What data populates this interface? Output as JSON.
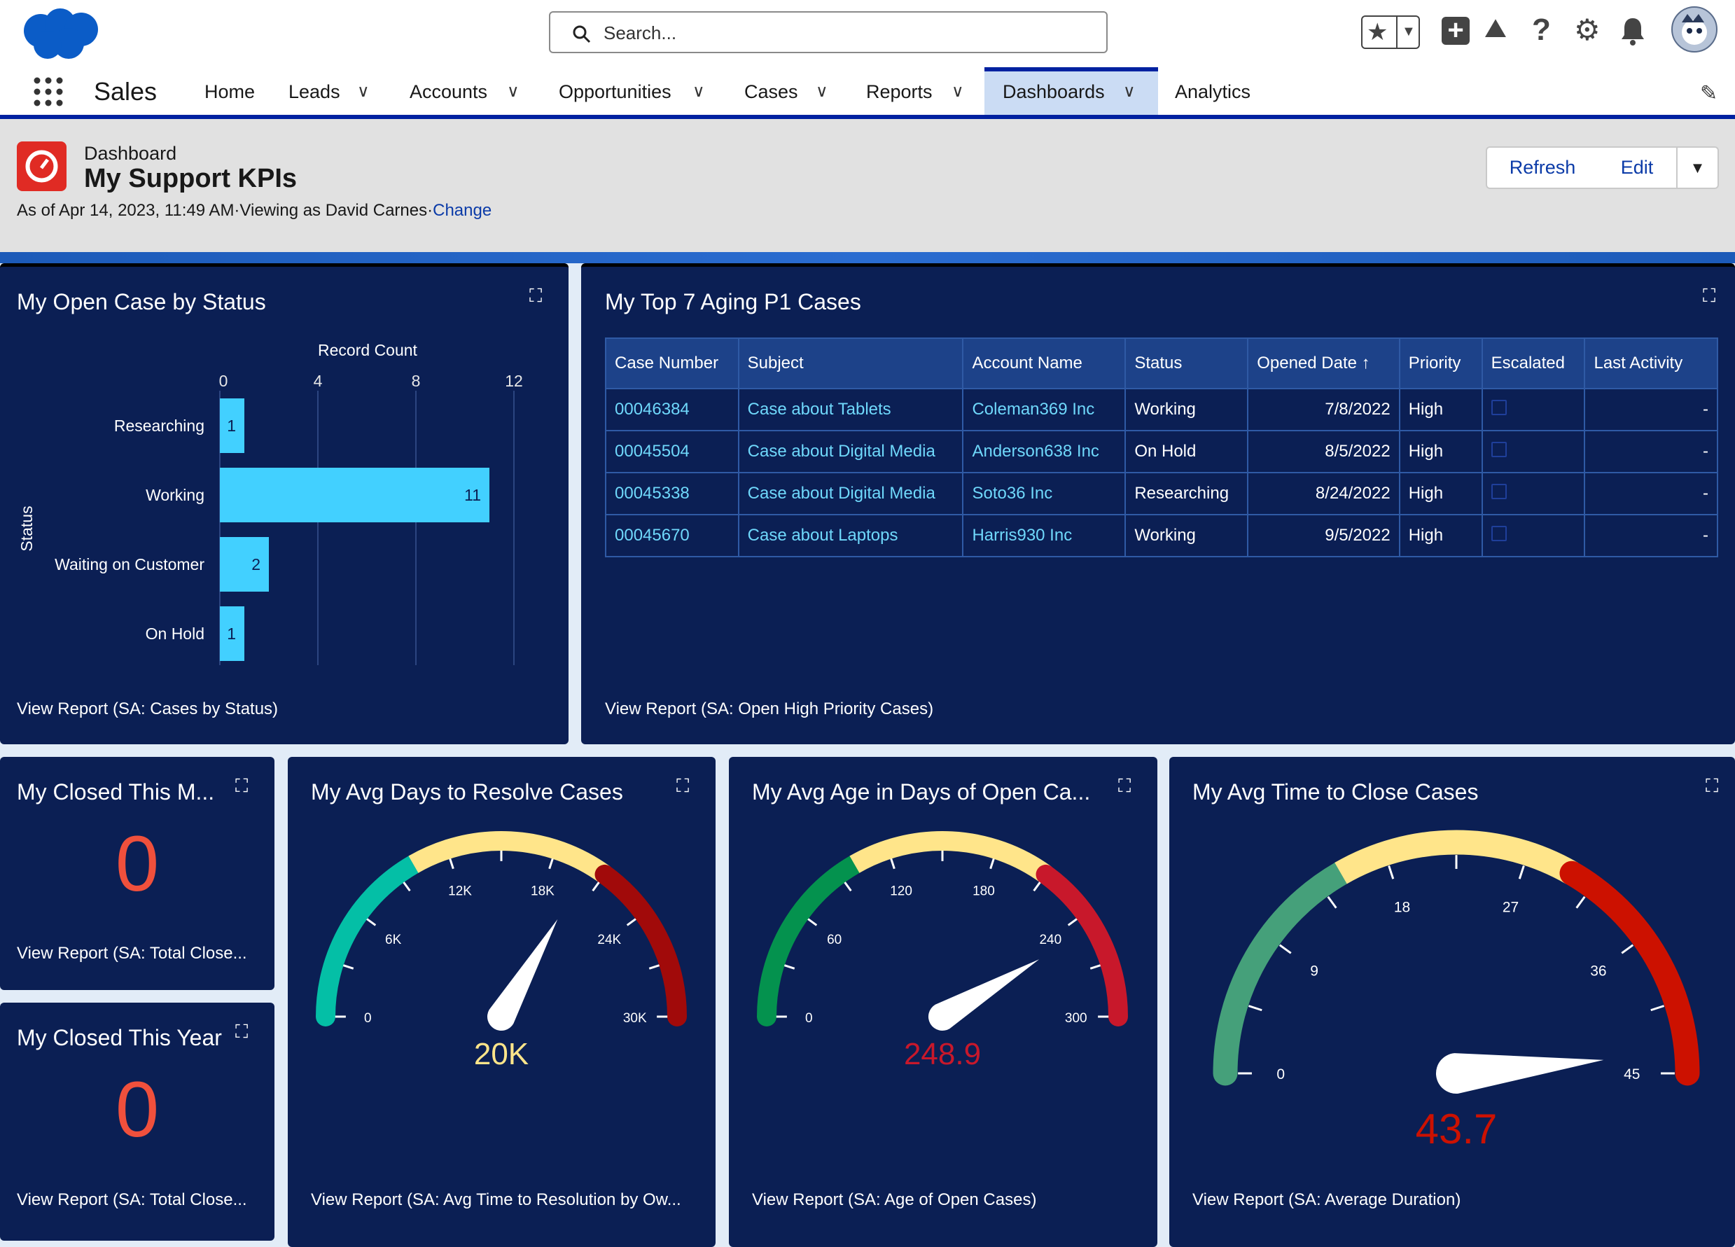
{
  "header": {
    "search_placeholder": "Search...",
    "app_name": "Sales",
    "nav": [
      "Home",
      "Leads",
      "Accounts",
      "Opportunities",
      "Cases",
      "Reports",
      "Dashboards",
      "Analytics"
    ],
    "icons": [
      "salesforce-cloud-logo",
      "favorites-star-icon",
      "favorites-dropdown-icon",
      "global-create-icon",
      "trailhead-icon",
      "help-icon",
      "setup-gear-icon",
      "notifications-bell-icon",
      "avatar"
    ]
  },
  "page": {
    "object_label": "Dashboard",
    "title": "My Support KPIs",
    "as_of": "As of Apr 14, 2023, 11:49 AM·Viewing as David Carnes·",
    "change_link": "Change",
    "refresh": "Refresh",
    "edit": "Edit"
  },
  "colors": {
    "panel": "#0b1f54",
    "bar": "#42d0ff",
    "accent": "#0021a0",
    "link": "#6fd8fb"
  },
  "status_chart": {
    "title": "My Open Case by Status",
    "view_report": "View Report (SA: Cases by Status)",
    "chart_data": {
      "type": "bar",
      "orientation": "horizontal",
      "categories": [
        "Researching",
        "Working",
        "Waiting on Customer",
        "On Hold"
      ],
      "values": [
        1,
        11,
        2,
        1
      ],
      "xlabel": "Record Count",
      "ylabel": "Status",
      "xlim": [
        0,
        12
      ],
      "ticks": [
        "0",
        "4",
        "8",
        "12"
      ],
      "grid": true
    }
  },
  "aging": {
    "title": "My Top 7 Aging P1 Cases",
    "view_report": "View Report (SA: Open High Priority Cases)",
    "columns": [
      "Case Number",
      "Subject",
      "Account Name",
      "Status",
      "Opened Date ↑",
      "Priority",
      "Escalated",
      "Last Activity"
    ],
    "rows": [
      [
        "00046384",
        "Case about Tablets",
        "Coleman369 Inc",
        "Working",
        "7/8/2022",
        "High",
        "",
        "-"
      ],
      [
        "00045504",
        "Case about Digital Media",
        "Anderson638 Inc",
        "On Hold",
        "8/5/2022",
        "High",
        "",
        "-"
      ],
      [
        "00045338",
        "Case about Digital Media",
        "Soto36 Inc",
        "Researching",
        "8/24/2022",
        "High",
        "",
        "-"
      ],
      [
        "00045670",
        "Case about Laptops",
        "Harris930 Inc",
        "Working",
        "9/5/2022",
        "High",
        "",
        "-"
      ]
    ]
  },
  "closed_month": {
    "title": "My Closed This M...",
    "value": "0",
    "view_report": "View Report (SA: Total Close..."
  },
  "closed_year": {
    "title": "My Closed This Year",
    "value": "0",
    "view_report": "View Report (SA: Total Close..."
  },
  "gauges": [
    {
      "title": "My Avg Days to Resolve Cases",
      "view_report": "View Report (SA: Avg Time to Resolution by Ow...",
      "min": 0,
      "max": 30000,
      "value": 20000,
      "display": "20K",
      "labels": [
        "0",
        "6K",
        "12K",
        "18K",
        "24K",
        "30K"
      ],
      "bands": [
        10000,
        21000
      ],
      "colors": [
        "#04bfa6",
        "#ffe58a",
        "#a10a0a"
      ],
      "value_color": "#ffe58a"
    },
    {
      "title": "My Avg Age in Days of Open Ca...",
      "view_report": "View Report (SA: Age of Open Cases)",
      "min": 0,
      "max": 300,
      "value": 248.9,
      "display": "248.9",
      "labels": [
        "0",
        "60",
        "120",
        "180",
        "240",
        "300"
      ],
      "bands": [
        100,
        210
      ],
      "colors": [
        "#04924e",
        "#ffe58a",
        "#c8182b"
      ],
      "value_color": "#c8182b"
    },
    {
      "title": "My Avg Time to Close Cases",
      "view_report": "View Report (SA: Average Duration)",
      "min": 0,
      "max": 45,
      "value": 43.7,
      "display": "43.7",
      "labels": [
        "0",
        "9",
        "18",
        "27",
        "36",
        "45"
      ],
      "bands": [
        15,
        30
      ],
      "colors": [
        "#45a07a",
        "#ffe58a",
        "#cc1100"
      ],
      "value_color": "#cc1100"
    }
  ]
}
